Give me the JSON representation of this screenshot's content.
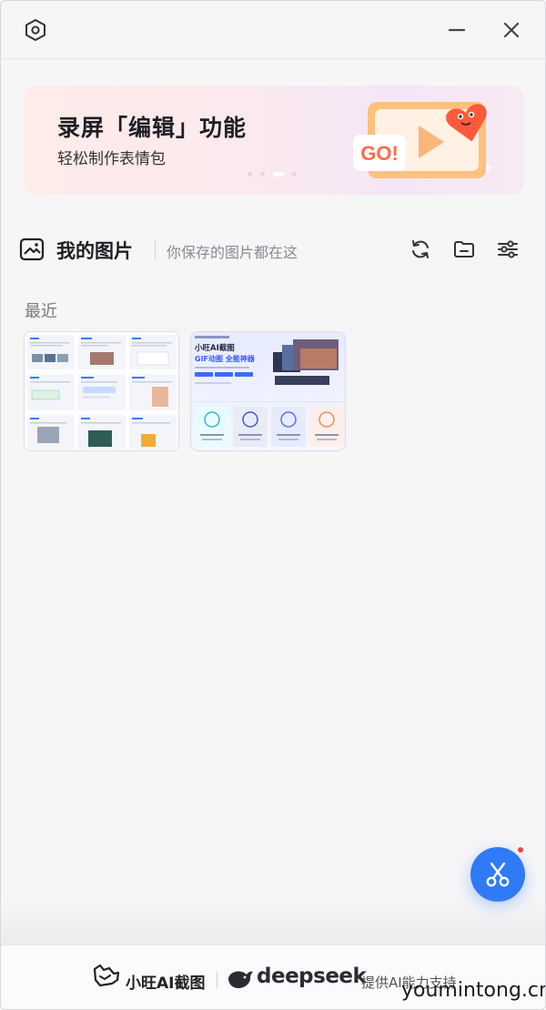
{
  "titlebar": {
    "settings_icon": "settings-hexagon-icon",
    "minimize_icon": "minimize-icon",
    "close_icon": "close-icon"
  },
  "banner": {
    "title": "录屏「编辑」功能",
    "subtitle": "轻松制作表情包",
    "badge_text": "GO!",
    "slides_total": 4,
    "active_slide": 3,
    "accent_color": "#ff6b4a"
  },
  "section": {
    "title": "我的图片",
    "subtitle": "你保存的图片都在这",
    "actions": [
      "refresh-icon",
      "folder-icon",
      "filter-sliders-icon"
    ]
  },
  "recent": {
    "label": "最近",
    "thumb2_title_line1": "小旺AI截图",
    "thumb2_title_line2": "GIF动图 全能神器"
  },
  "fab": {
    "icon": "scissors-icon",
    "color": "#2f7af5",
    "badge_color": "#f04438"
  },
  "footer": {
    "brand": "小旺AI截图",
    "partner": "deepseek",
    "note": "提供AI能力支持",
    "watermark": "youmintong.cn"
  }
}
